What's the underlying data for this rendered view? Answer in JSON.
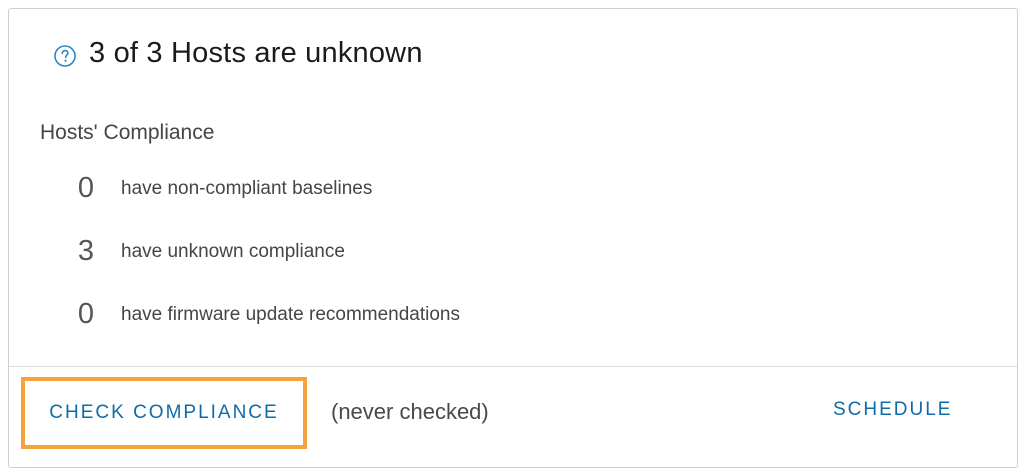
{
  "header": {
    "icon": "help-circle-icon",
    "title": "3 of 3 Hosts are unknown"
  },
  "compliance": {
    "section_title": "Hosts' Compliance",
    "stats": [
      {
        "count": "0",
        "label": "have non-compliant baselines"
      },
      {
        "count": "3",
        "label": "have unknown compliance"
      },
      {
        "count": "0",
        "label": "have firmware update recommendations"
      }
    ]
  },
  "footer": {
    "check_label": "CHECK COMPLIANCE",
    "last_checked": "(never checked)",
    "schedule_label": "SCHEDULE"
  },
  "colors": {
    "accent_blue": "#0f6ba8",
    "highlight_orange": "#f3a23d"
  }
}
